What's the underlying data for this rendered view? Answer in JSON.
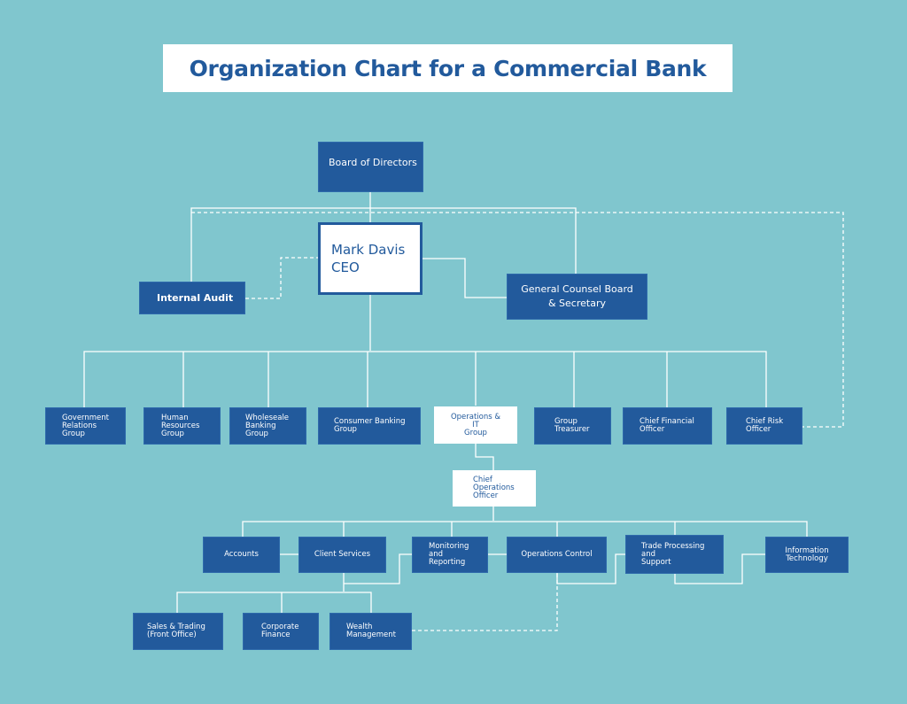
{
  "title": "Organization Chart for a Commercial Bank",
  "colors": {
    "background": "#80c6ce",
    "box_fill": "#225a9c",
    "box_text": "#ffffff",
    "highlight_fill": "#ffffff",
    "highlight_text": "#225a9c",
    "connector": "#ffffff"
  },
  "nodes": {
    "board": {
      "lines": [
        "Board of Directors"
      ]
    },
    "ceo": {
      "lines": [
        "Mark Davis",
        "CEO"
      ]
    },
    "internal_audit": {
      "lines": [
        "Internal Audit"
      ]
    },
    "general_counsel": {
      "lines": [
        "General Counsel Board",
        "& Secretary"
      ]
    },
    "gov_relations": {
      "lines": [
        "Government",
        "Relations",
        "Group"
      ]
    },
    "human_resources": {
      "lines": [
        "Human",
        "Resources",
        "Group"
      ]
    },
    "wholesale_banking": {
      "lines": [
        "Wholeseale",
        "Banking",
        "Group"
      ]
    },
    "consumer_banking": {
      "lines": [
        "Consumer Banking",
        "Group"
      ]
    },
    "operations_it": {
      "lines": [
        "Operations &",
        "IT",
        "Group"
      ]
    },
    "group_treasurer": {
      "lines": [
        "Group",
        "Treasurer"
      ]
    },
    "cfo": {
      "lines": [
        "Chief Financial",
        "Officer"
      ]
    },
    "cro": {
      "lines": [
        "Chief Risk",
        "Officer"
      ]
    },
    "coo": {
      "lines": [
        "Chief",
        "Operations",
        "Officer"
      ]
    },
    "accounts": {
      "lines": [
        "Accounts"
      ]
    },
    "client_services": {
      "lines": [
        "Client Services"
      ]
    },
    "monitoring": {
      "lines": [
        "Monitoring",
        "and",
        "Reporting"
      ]
    },
    "operations_control": {
      "lines": [
        "Operations Control"
      ]
    },
    "trade_processing": {
      "lines": [
        "Trade Processing",
        "and",
        "Support"
      ]
    },
    "information_technology": {
      "lines": [
        "Information",
        "Technology"
      ]
    },
    "sales_trading": {
      "lines": [
        "Sales & Trading",
        "(Front Office)"
      ]
    },
    "corporate_finance": {
      "lines": [
        "Corporate",
        "Finance"
      ]
    },
    "wealth_management": {
      "lines": [
        "Wealth",
        "Management"
      ]
    }
  }
}
